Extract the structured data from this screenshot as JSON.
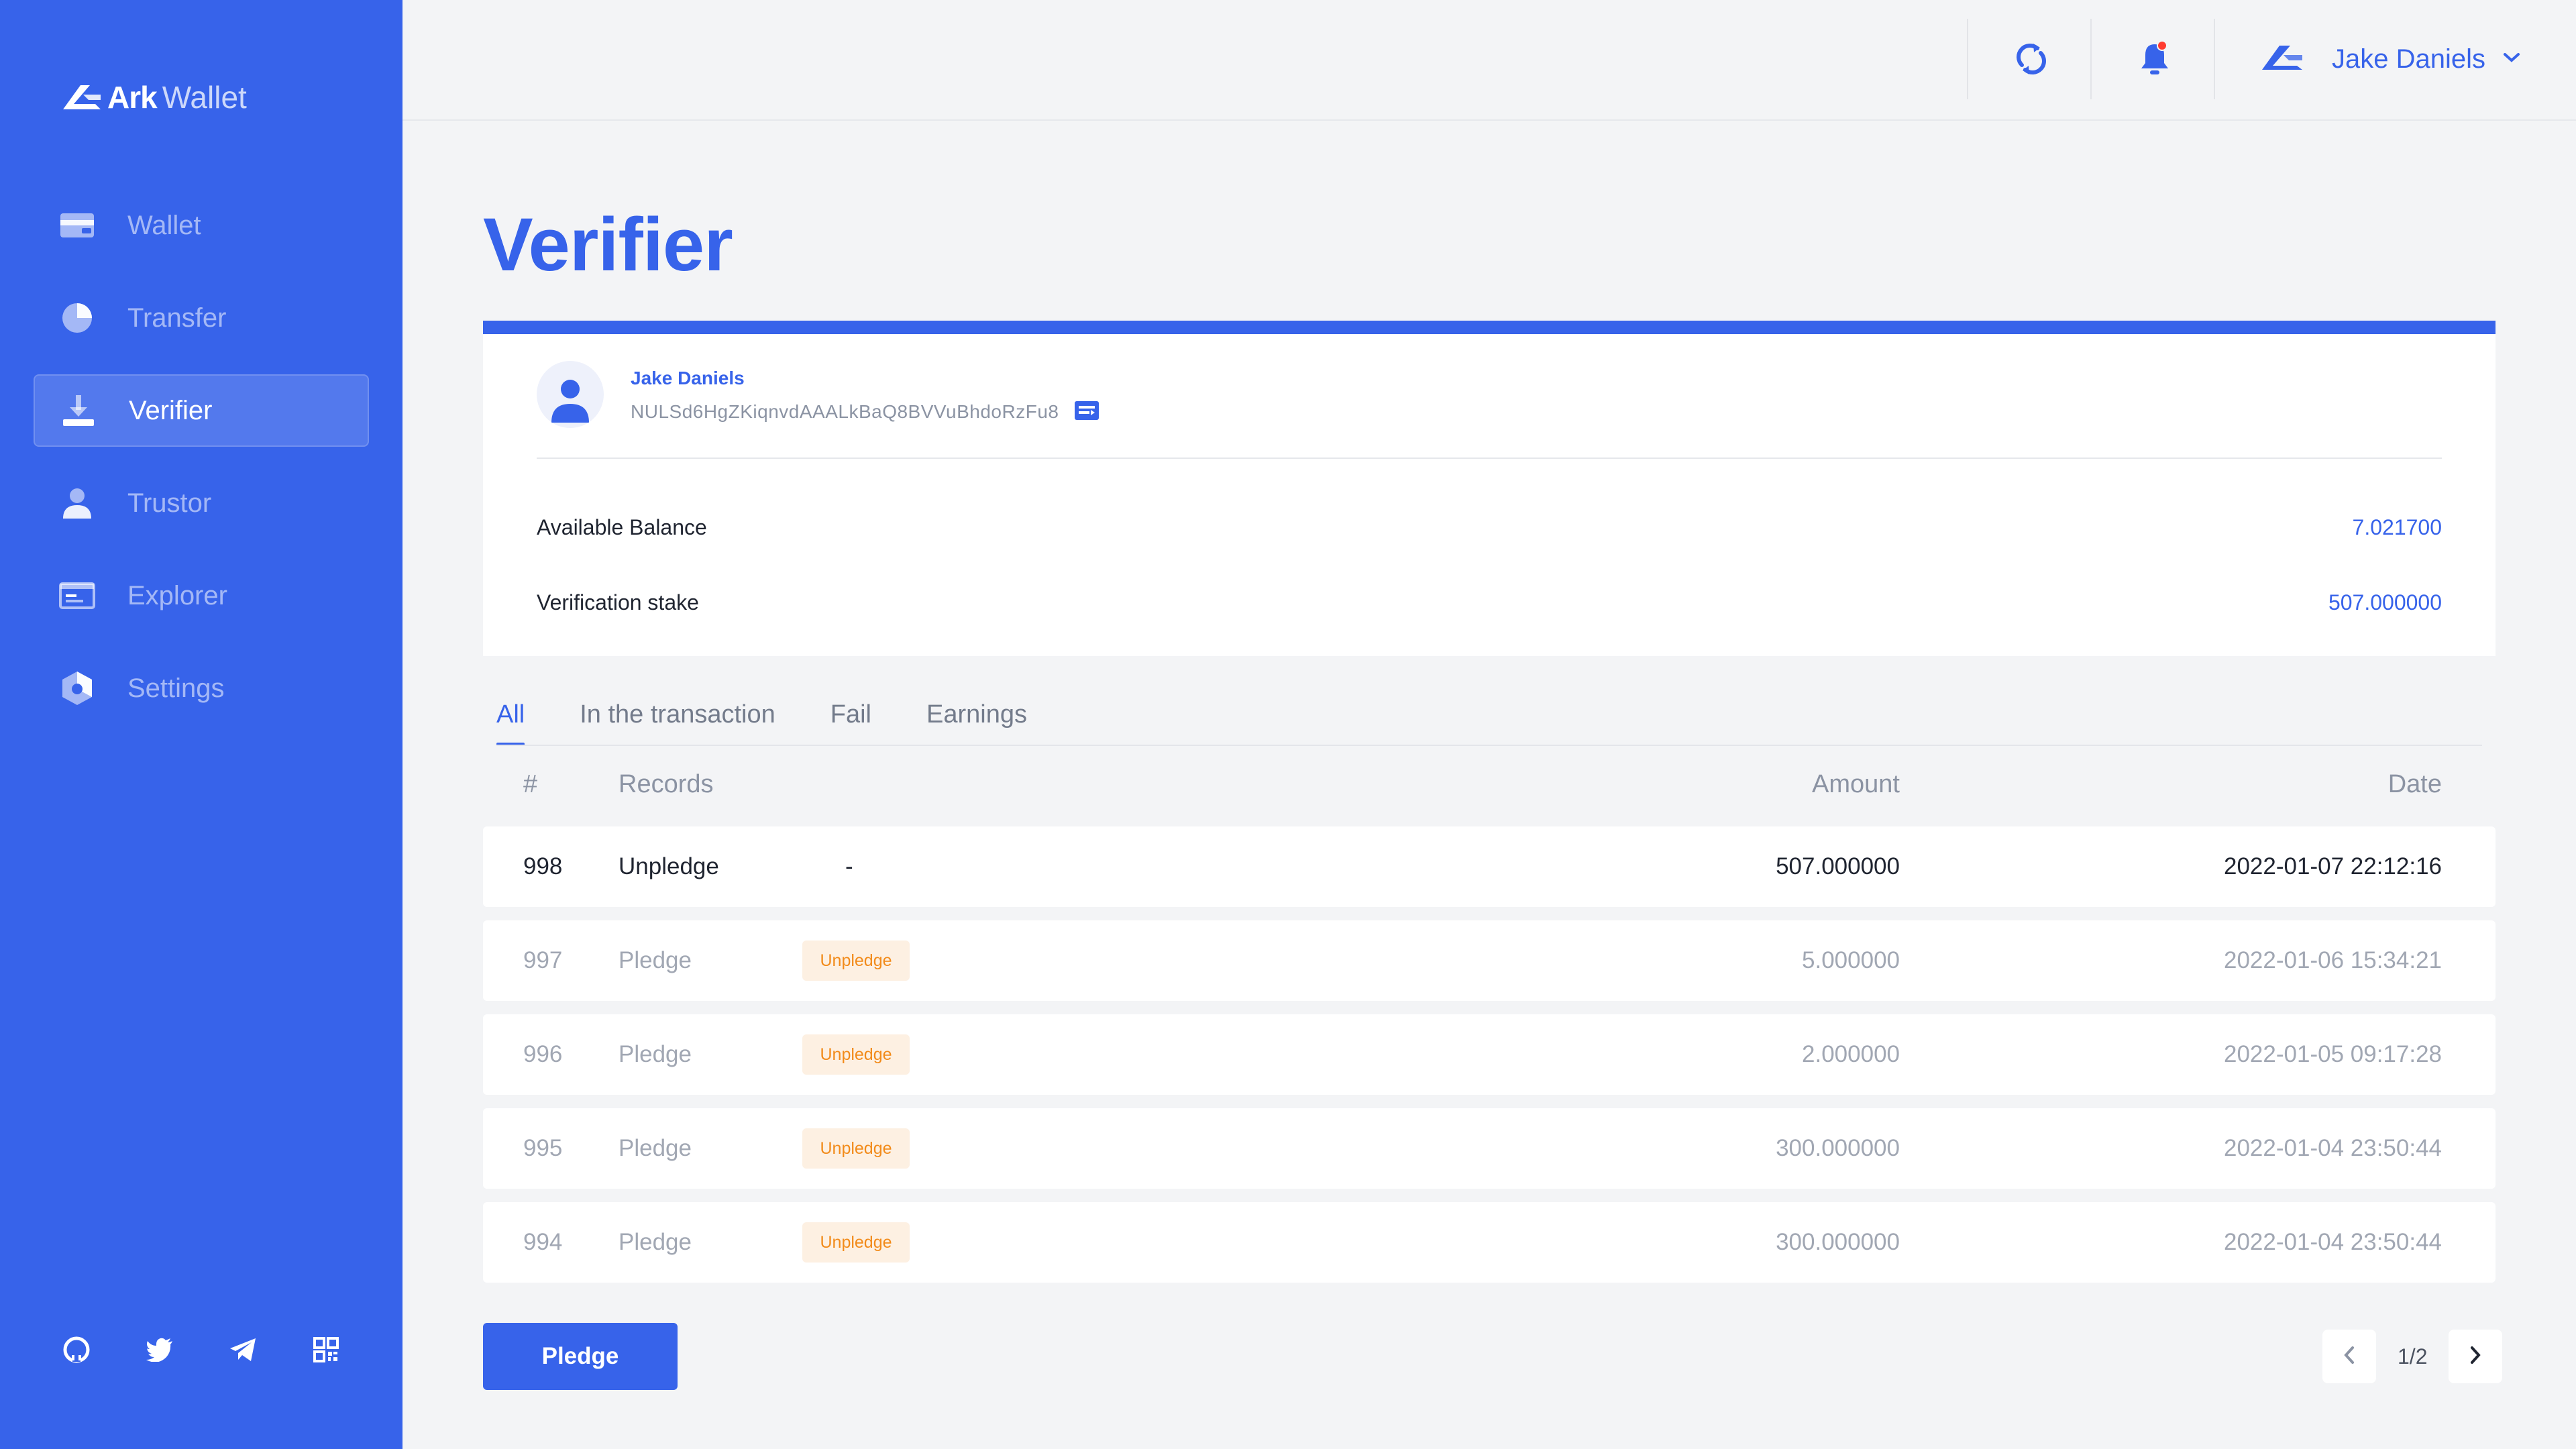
{
  "app": {
    "brand_bold": "Ark",
    "brand_light": "Wallet",
    "accent_color": "#3763ea"
  },
  "sidebar": {
    "items": [
      {
        "label": "Wallet",
        "icon": "wallet-icon",
        "active": false
      },
      {
        "label": "Transfer",
        "icon": "pie-chart-icon",
        "active": false
      },
      {
        "label": "Verifier",
        "icon": "download-icon",
        "active": true
      },
      {
        "label": "Trustor",
        "icon": "user-icon",
        "active": false
      },
      {
        "label": "Explorer",
        "icon": "browser-icon",
        "active": false
      },
      {
        "label": "Settings",
        "icon": "hexagon-settings-icon",
        "active": false
      }
    ],
    "social": [
      "github-icon",
      "twitter-icon",
      "telegram-icon",
      "qr-code-icon"
    ]
  },
  "topbar": {
    "refresh_icon": "refresh-icon",
    "notification_icon": "bell-icon",
    "user_name": "Jake Daniels"
  },
  "page": {
    "title": "Verifier"
  },
  "account": {
    "name": "Jake Daniels",
    "address": "NULSd6HgZKiqnvdAAALkBaQ8BVVuBhdoRzFu8",
    "available_balance_label": "Available Balance",
    "available_balance_value": "7.021700",
    "verification_stake_label": "Verification stake",
    "verification_stake_value": "507.000000"
  },
  "tabs": [
    {
      "label": "All",
      "active": true
    },
    {
      "label": "In the transaction",
      "active": false
    },
    {
      "label": "Fail",
      "active": false
    },
    {
      "label": "Earnings",
      "active": false
    }
  ],
  "table": {
    "headers": {
      "num": "#",
      "records": "Records",
      "amount": "Amount",
      "date": "Date"
    },
    "rows": [
      {
        "num": "998",
        "record": "Unpledge",
        "extra": "-",
        "badge": "",
        "amount": "507.000000",
        "date": "2022-01-07   22:12:16"
      },
      {
        "num": "997",
        "record": "Pledge",
        "extra": "",
        "badge": "Unpledge",
        "amount": "5.000000",
        "date": "2022-01-06   15:34:21"
      },
      {
        "num": "996",
        "record": "Pledge",
        "extra": "",
        "badge": "Unpledge",
        "amount": "2.000000",
        "date": "2022-01-05   09:17:28"
      },
      {
        "num": "995",
        "record": "Pledge",
        "extra": "",
        "badge": "Unpledge",
        "amount": "300.000000",
        "date": "2022-01-04   23:50:44"
      },
      {
        "num": "994",
        "record": "Pledge",
        "extra": "",
        "badge": "Unpledge",
        "amount": "300.000000",
        "date": "2022-01-04   23:50:44"
      }
    ]
  },
  "actions": {
    "pledge_label": "Pledge"
  },
  "pagination": {
    "label": "1/2"
  }
}
